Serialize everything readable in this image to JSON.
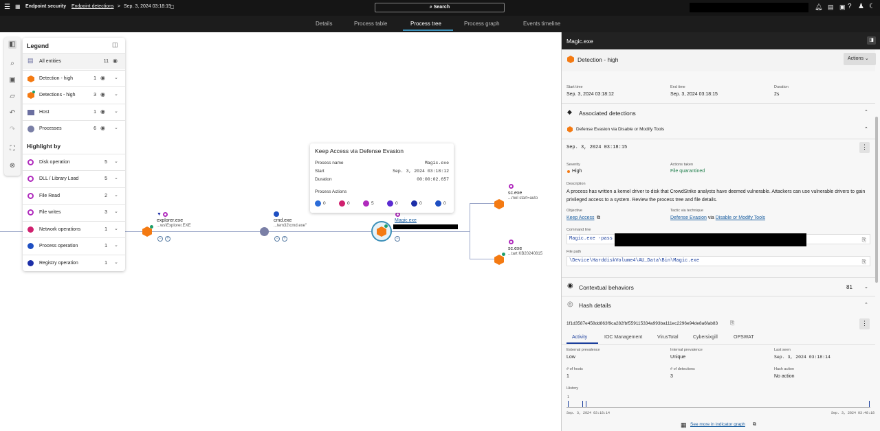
{
  "topbar": {
    "app_name": "Endpoint security",
    "breadcrumb_link": "Endpoint detections",
    "breadcrumb_separator": ">",
    "breadcrumb_date": "Sep. 3, 2024 03:18:15",
    "search_label": "Search",
    "icons": [
      "hamburger-icon",
      "falcon-logo-icon",
      "bookmark-icon",
      "bell-icon",
      "news-icon",
      "apps-icon",
      "help-icon",
      "user-icon",
      "theme-icon"
    ]
  },
  "tabs": [
    {
      "label": "Details",
      "active": false
    },
    {
      "label": "Process table",
      "active": false
    },
    {
      "label": "Process tree",
      "active": true
    },
    {
      "label": "Process graph",
      "active": false
    },
    {
      "label": "Events timeline",
      "active": false
    }
  ],
  "legend": {
    "title": "Legend",
    "entities": [
      {
        "label": "All entities",
        "count": "11"
      },
      {
        "label": "Detection - high",
        "count": "1"
      },
      {
        "label": "Detections - high",
        "count": "3"
      },
      {
        "label": "Host",
        "count": "1"
      },
      {
        "label": "Processes",
        "count": "6"
      }
    ],
    "highlight_title": "Highlight by",
    "highlights": [
      {
        "label": "Disk operation",
        "count": "5",
        "color": "#b02bbd"
      },
      {
        "label": "DLL / Library Load",
        "count": "5",
        "color": "#b02bbd"
      },
      {
        "label": "File Read",
        "count": "2",
        "color": "#b02bbd"
      },
      {
        "label": "File writes",
        "count": "3",
        "color": "#b02bbd"
      },
      {
        "label": "Network operations",
        "count": "1",
        "color": "#d0216f"
      },
      {
        "label": "Process operation",
        "count": "1",
        "color": "#1e4fc2"
      },
      {
        "label": "Registry operation",
        "count": "1",
        "color": "#1d2fa8"
      }
    ]
  },
  "graph": {
    "explorer": {
      "name": "explorer.exe",
      "path": "...ws\\Explorer.EXE"
    },
    "cmd": {
      "name": "cmd.exe",
      "path": "...tem32\\cmd.exe\""
    },
    "magic": {
      "name": "Magic.exe"
    },
    "sc1": {
      "name": "sc.exe",
      "path": "...mel start=auto"
    },
    "sc2": {
      "name": "sc.exe",
      "path": "...tart KB20240815"
    }
  },
  "popup": {
    "title": "Keep Access via Defense Evasion",
    "rows": [
      {
        "key": "Process name",
        "value": "Magic.exe"
      },
      {
        "key": "Start",
        "value": "Sep. 3, 2024 03:18:12"
      },
      {
        "key": "Duration",
        "value": "00:00:02.657"
      }
    ],
    "actions_title": "Process Actions",
    "actions": [
      {
        "count": "0",
        "color": "#2b6cd8"
      },
      {
        "count": "0",
        "color": "#d0216f"
      },
      {
        "count": "5",
        "color": "#b02bbd"
      },
      {
        "count": "0",
        "color": "#5b2bd1"
      },
      {
        "count": "0",
        "color": "#1d2fa8"
      },
      {
        "count": "0",
        "color": "#1e4fc2"
      }
    ]
  },
  "panel": {
    "title": "Magic.exe",
    "severity_title": "Detection - high",
    "actions_button": "Actions",
    "start_label": "Start time",
    "start_value": "Sep. 3, 2024 03:18:12",
    "end_label": "End time",
    "end_value": "Sep. 3, 2024 03:18:15",
    "duration_label": "Duration",
    "duration_value": "2s",
    "assoc_title": "Associated detections",
    "detection_name": "Defense Evasion via Disable or Modify Tools",
    "detection_time": "Sep. 3, 2024 03:18:15",
    "severity_label": "Severity",
    "severity_value": "High",
    "actions_taken_label": "Actions taken",
    "actions_taken_value": "File quarantined",
    "description_label": "Description",
    "description": "A process has written a kernel driver to disk that CrowdStrike analysts have deemed vulnerable. Attackers can use vulnerable drivers to gain privileged access to a system. Review the process tree and file details.",
    "objective_label": "Objective",
    "objective_value": "Keep Access",
    "tactic_label": "Tactic via technique",
    "tactic_value": "Defense Evasion",
    "tactic_via": "via",
    "technique_value": "Disable or Modify Tools",
    "cmdline_label": "Command line",
    "cmdline_value": "Magic.exe -pass",
    "filepath_label": "File path",
    "filepath_value": "\\Device\\HarddiskVolume4\\AU_Data\\Bin\\Magic.exe",
    "contextual_title": "Contextual behaviors",
    "contextual_count": "81",
    "hash_title": "Hash details",
    "hash_value": "1f1d3587e458dd863f9ca282fbf559115334a993ba111ec2296e94de8a6fab83",
    "hash_tabs": [
      "Activity",
      "IOC Management",
      "VirusTotal",
      "Cybersixgill",
      "OPSWAT"
    ],
    "ext_prev_label": "External prevalence",
    "ext_prev_value": "Low",
    "int_prev_label": "Internal prevalence",
    "int_prev_value": "Unique",
    "last_seen_label": "Last seen",
    "last_seen_value": "Sep. 3, 2024 03:18:14",
    "hosts_label": "# of hosts",
    "hosts_value": "1",
    "detections_label": "# of detections",
    "detections_value": "3",
    "hash_action_label": "Hash action",
    "hash_action_value": "No action",
    "history_label": "History",
    "history_y": "1",
    "history_start": "Sep. 3, 2024 03:18:14",
    "history_end": "Sep. 3, 2024 03:48:18",
    "see_more": "See more in indicator graph"
  },
  "colors": {
    "accent": "#3b8fb8",
    "detection_orange": "#f47a12",
    "topbar": "#151515",
    "link": "#1a5ea0"
  }
}
